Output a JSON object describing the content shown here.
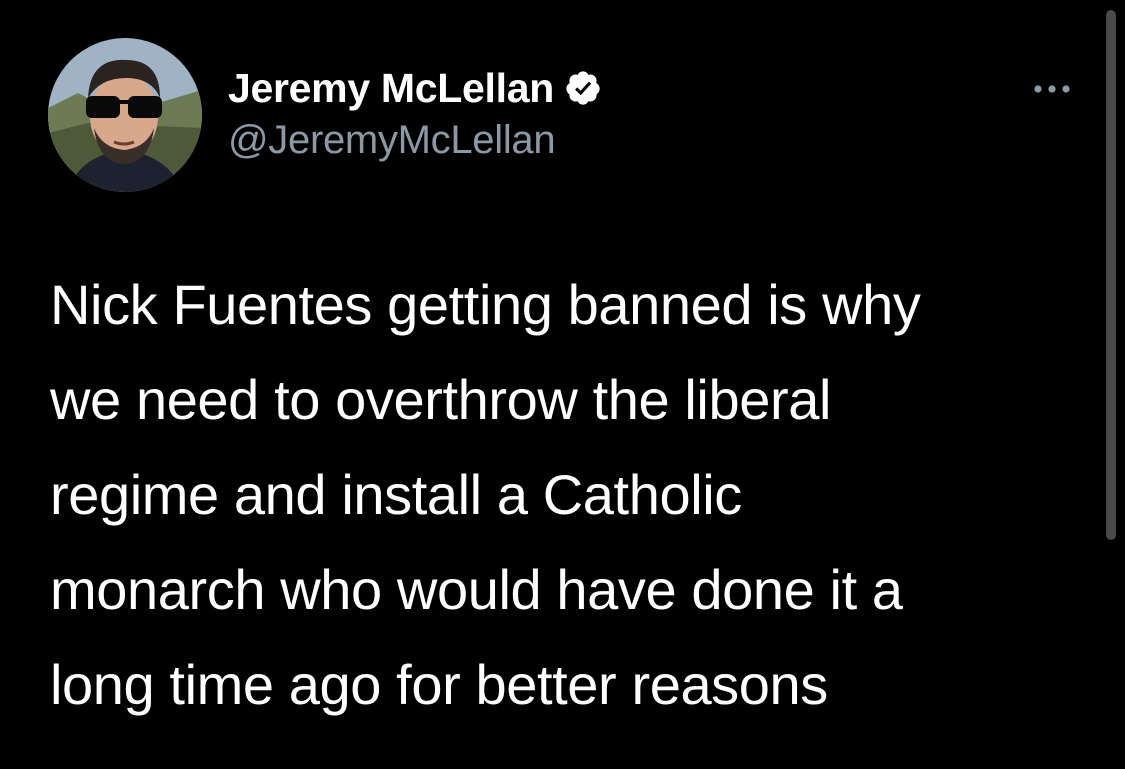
{
  "author": {
    "display_name": "Jeremy McLellan",
    "handle": "@JeremyMcLellan",
    "verified": true,
    "avatar_icon": "profile-photo-avatar"
  },
  "tweet": {
    "text": "Nick Fuentes getting banned is why\nwe need to overthrow the liberal\nregime and install a Catholic\nmonarch who would have done it a\nlong time ago for better reasons"
  },
  "icons": {
    "verified": "verified-badge-icon",
    "more": "more-options-icon"
  },
  "colors": {
    "background": "#000000",
    "text_primary": "#ffffff",
    "text_secondary": "#8b98a5"
  }
}
